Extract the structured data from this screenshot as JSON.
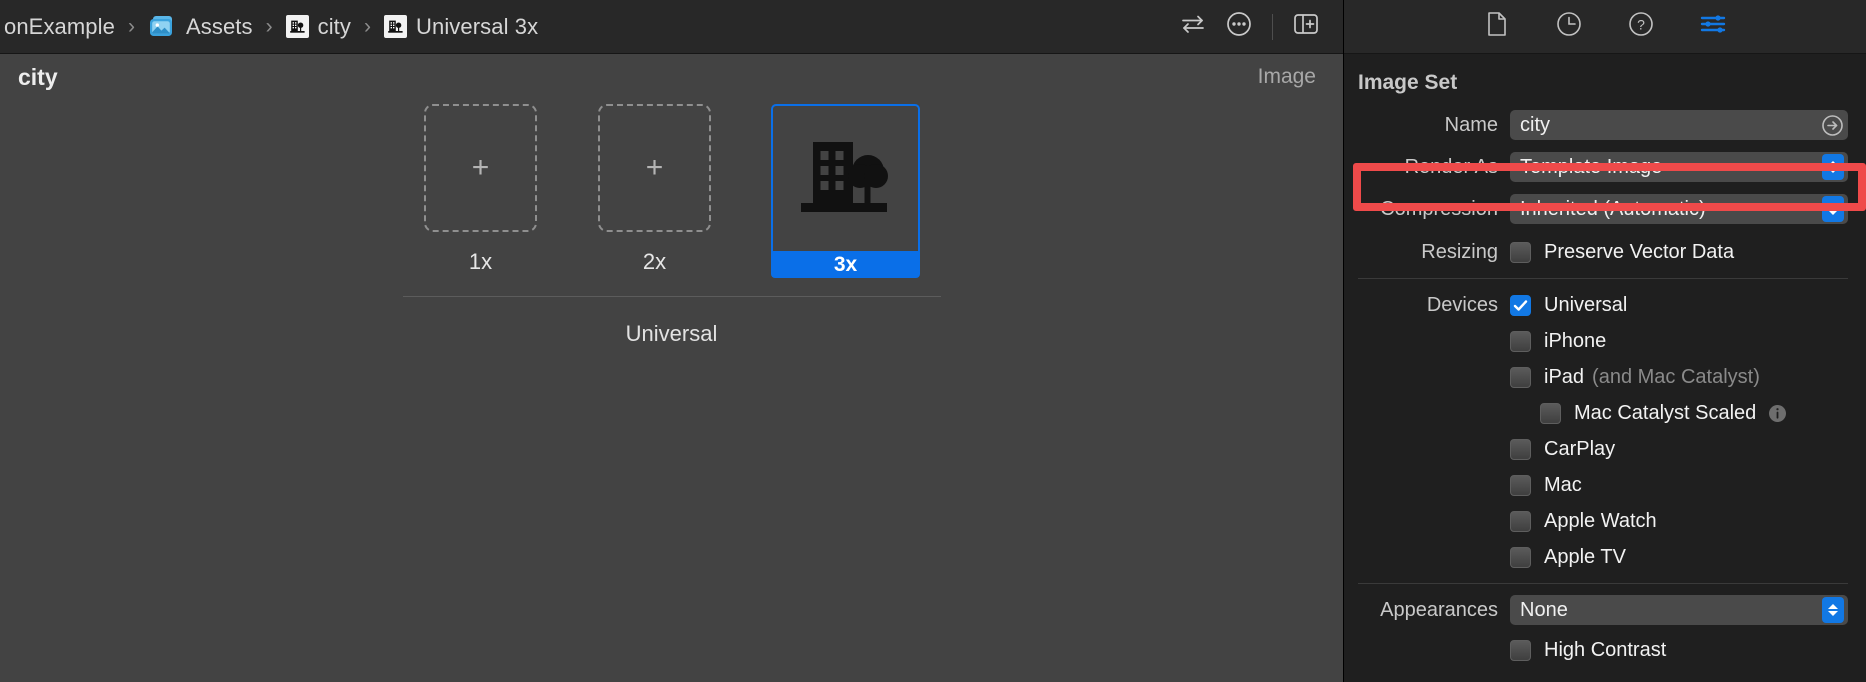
{
  "breadcrumb": {
    "items": [
      {
        "label": "onExample",
        "icon": "none"
      },
      {
        "label": "Assets",
        "icon": "assets-folder-icon"
      },
      {
        "label": "city",
        "icon": "image-set-icon"
      },
      {
        "label": "Universal 3x",
        "icon": "image-set-icon"
      }
    ],
    "separator": "›"
  },
  "toolbar": {
    "actions": [
      {
        "name": "compare-versions-icon",
        "title": "Compare"
      },
      {
        "name": "more-options-icon",
        "title": "More"
      },
      {
        "name": "toggle-inspector-icon",
        "title": "Inspector"
      }
    ]
  },
  "inspector_tabs": [
    {
      "name": "file-inspector-icon",
      "selected": false
    },
    {
      "name": "history-inspector-icon",
      "selected": false
    },
    {
      "name": "quick-help-inspector-icon",
      "selected": false
    },
    {
      "name": "attributes-inspector-icon",
      "selected": true
    }
  ],
  "editor": {
    "title": "city",
    "kind": "Image",
    "group_label": "Universal",
    "slots": [
      {
        "label": "1x",
        "filled": false,
        "plus": "+",
        "selected": false
      },
      {
        "label": "2x",
        "filled": false,
        "plus": "+",
        "selected": false
      },
      {
        "label": "3x",
        "filled": true,
        "plus": "",
        "selected": true
      }
    ]
  },
  "inspector": {
    "section_title": "Image Set",
    "name": {
      "label": "Name",
      "value": "city"
    },
    "render_as": {
      "label": "Render As",
      "value": "Template Image",
      "highlighted": true
    },
    "compression": {
      "label": "Compression",
      "value": "Inherited (Automatic)"
    },
    "resizing": {
      "label": "Resizing",
      "option": {
        "label": "Preserve Vector Data",
        "checked": false
      }
    },
    "devices": {
      "label": "Devices",
      "items": [
        {
          "label": "Universal",
          "checked": true,
          "sub": "",
          "indent": false,
          "info": false
        },
        {
          "label": "iPhone",
          "checked": false,
          "sub": "",
          "indent": false,
          "info": false
        },
        {
          "label": "iPad",
          "checked": false,
          "sub": "(and Mac Catalyst)",
          "indent": false,
          "info": false
        },
        {
          "label": "Mac Catalyst Scaled",
          "checked": false,
          "sub": "",
          "indent": true,
          "info": true
        },
        {
          "label": "CarPlay",
          "checked": false,
          "sub": "",
          "indent": false,
          "info": false
        },
        {
          "label": "Mac",
          "checked": false,
          "sub": "",
          "indent": false,
          "info": false
        },
        {
          "label": "Apple Watch",
          "checked": false,
          "sub": "",
          "indent": false,
          "info": false
        },
        {
          "label": "Apple TV",
          "checked": false,
          "sub": "",
          "indent": false,
          "info": false
        }
      ]
    },
    "appearances": {
      "label": "Appearances",
      "value": "None"
    },
    "high_contrast": {
      "label": "High Contrast",
      "checked": false
    }
  },
  "colors": {
    "accent_blue": "#0a6fe8",
    "control_blue": "#1278e4",
    "highlight_red": "#ef4a4a",
    "canvas_bg": "#434343",
    "inspector_bg": "#1f1f1f",
    "toolbar_bg": "#282828"
  }
}
